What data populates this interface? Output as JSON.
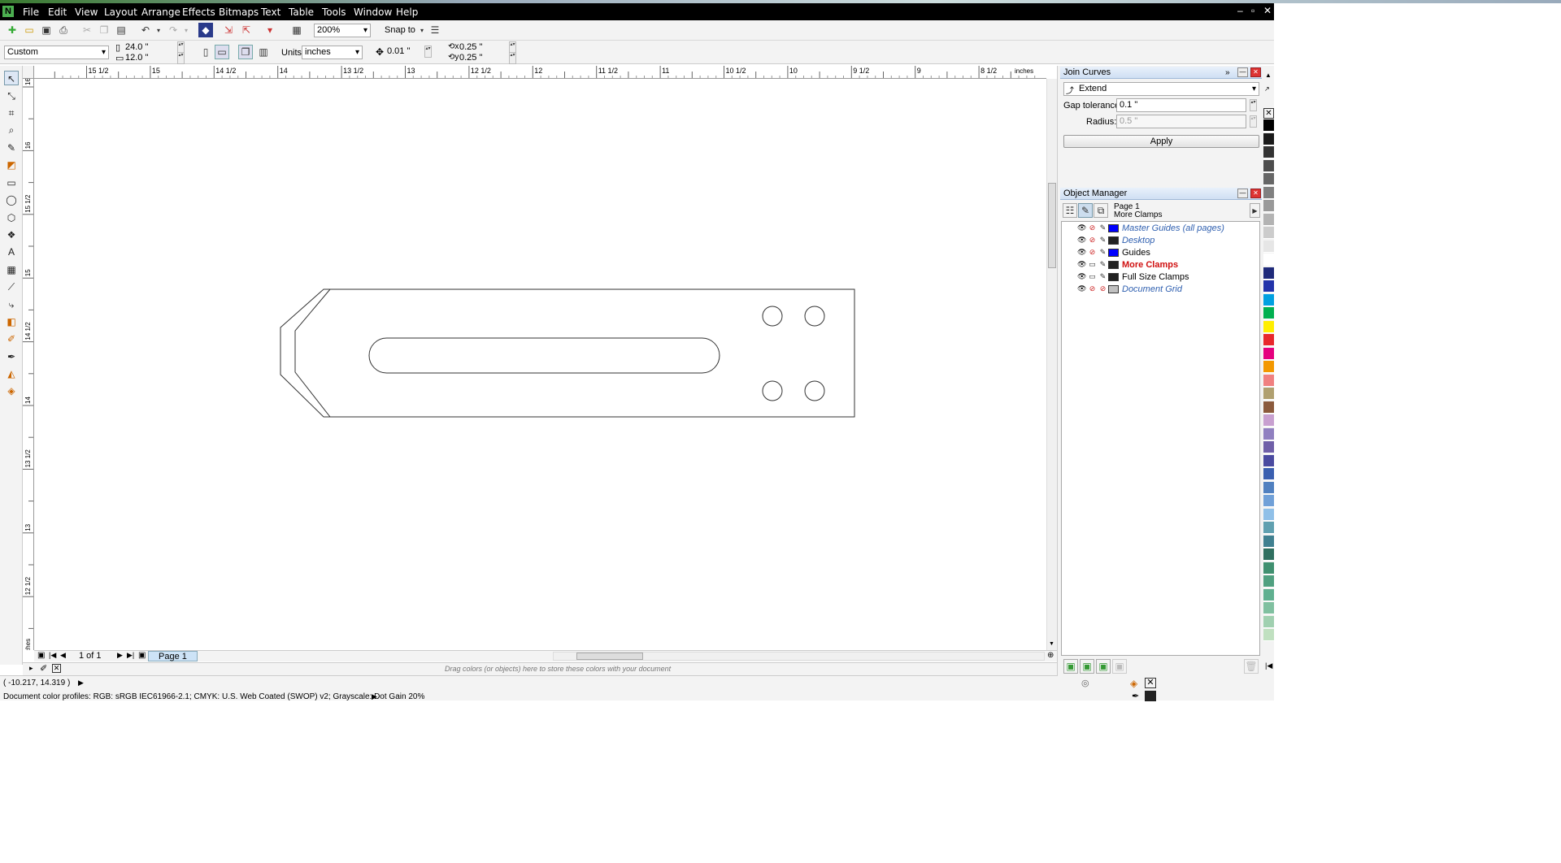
{
  "menu": [
    "File",
    "Edit",
    "View",
    "Layout",
    "Arrange",
    "Effects",
    "Bitmaps",
    "Text",
    "Table",
    "Tools",
    "Window",
    "Help"
  ],
  "toolbar": {
    "zoom": "200%",
    "snap_label": "Snap to"
  },
  "propbar": {
    "page_preset": "Custom",
    "width": "24.0 \"",
    "height": "12.0 \"",
    "units_label": "Units:",
    "units_value": "inches",
    "nudge": "0.01 \"",
    "dup_x": "0.25 \"",
    "dup_y": "0.25 \""
  },
  "ruler": {
    "h_labels": [
      "15 1/2",
      "15",
      "14 1/2",
      "14",
      "13 1/2",
      "13",
      "12 1/2",
      "12",
      "11 1/2",
      "11",
      "10 1/2",
      "10",
      "9 1/2",
      "9",
      "8 1/2"
    ],
    "unit": "inches",
    "v_labels": [
      "16",
      "16",
      "15 1/2",
      "15",
      "14 1/2",
      "14",
      "13 1/2",
      "13",
      "12 1/2",
      "inches"
    ]
  },
  "join_curves": {
    "title": "Join Curves",
    "mode": "Extend",
    "gap_label": "Gap tolerance:",
    "gap_value": "0.1 \"",
    "radius_label": "Radius:",
    "radius_value": "0.5 \"",
    "apply_label": "Apply"
  },
  "object_manager": {
    "title": "Object Manager",
    "page": "Page 1",
    "current_layer": "More Clamps",
    "layers": [
      {
        "name": "Master Guides (all pages)",
        "color": "#0000ff",
        "style": "master"
      },
      {
        "name": "Desktop",
        "color": "#222222",
        "style": "master"
      },
      {
        "name": "Guides",
        "color": "#0000ff",
        "style": "normal"
      },
      {
        "name": "More Clamps",
        "color": "#222222",
        "style": "active"
      },
      {
        "name": "Full Size Clamps",
        "color": "#222222",
        "style": "normal"
      },
      {
        "name": "Document Grid",
        "color": "#c0c0c0",
        "style": "master"
      }
    ]
  },
  "page_nav": {
    "count": "1 of 1",
    "tab": "Page 1"
  },
  "doc_palette_hint": "Drag colors (or objects) here to store these colors with your document",
  "status": {
    "coords": "( -10.217, 14.319 )",
    "profiles": "Document color profiles: RGB: sRGB IEC61966-2.1; CMYK: U.S. Web Coated (SWOP) v2; Grayscale: Dot Gain 20%"
  },
  "colors": {
    "palette": [
      "#000000",
      "#1a1a1a",
      "#333333",
      "#4d4d4d",
      "#666666",
      "#808080",
      "#999999",
      "#b3b3b3",
      "#cccccc",
      "#e6e6e6",
      "#ffffff",
      "#1f2a7a",
      "#2233aa",
      "#00a0e0",
      "#00b050",
      "#ffee00",
      "#e8282c",
      "#e5007e",
      "#f39800",
      "#f08080",
      "#b0a070",
      "#8b5a3c",
      "#c8a0d0",
      "#9080c0",
      "#6f5fa8",
      "#4a4aa0",
      "#3a5fb0",
      "#5080c0",
      "#70a0d8",
      "#90c0e8",
      "#60a0b0",
      "#408090",
      "#307060",
      "#409070",
      "#50a080",
      "#60b090",
      "#80c0a0",
      "#a0d0b0",
      "#c0e0c0"
    ]
  }
}
